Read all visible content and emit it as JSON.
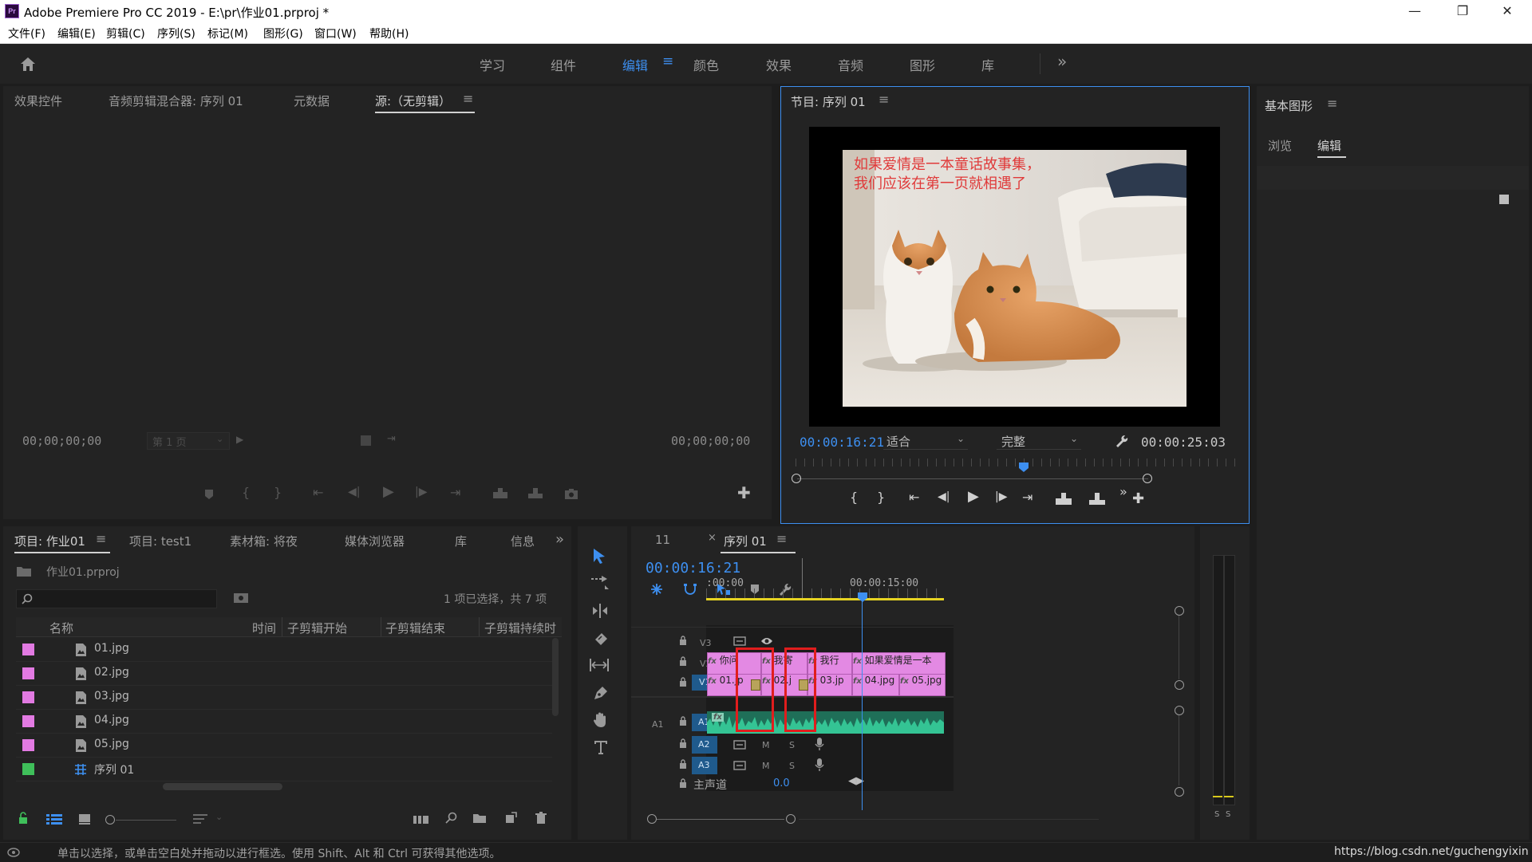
{
  "app": {
    "title": "Adobe Premiere Pro CC 2019 - E:\\pr\\作业01.prproj *",
    "logo": "Pr"
  },
  "menu": [
    "文件(F)",
    "编辑(E)",
    "剪辑(C)",
    "序列(S)",
    "标记(M)",
    "图形(G)",
    "窗口(W)",
    "帮助(H)"
  ],
  "workspaces": {
    "items": [
      "学习",
      "组件",
      "编辑",
      "颜色",
      "效果",
      "音频",
      "图形",
      "库"
    ],
    "active": "编辑",
    "more": "»"
  },
  "source_panel": {
    "tabs": [
      "效果控件",
      "音频剪辑混合器: 序列 01",
      "元数据",
      "源:（无剪辑）"
    ],
    "active_tab": "源:（无剪辑）",
    "timecode_left": "00;00;00;00",
    "page": "第 1 页",
    "timecode_right": "00;00;00;00"
  },
  "program_panel": {
    "title": "节目: 序列 01",
    "overlay_line1": "如果爱情是一本童话故事集，",
    "overlay_line2": "我们应该在第一页就相遇了",
    "timecode": "00:00:16:21",
    "fit": "适合",
    "quality": "完整",
    "duration": "00:00:25:03",
    "playhead_fraction": 0.65
  },
  "essential_graphics": {
    "title": "基本图形",
    "tabs": [
      "浏览",
      "编辑"
    ],
    "active_tab": "编辑"
  },
  "project_panel": {
    "tabs": [
      "项目: 作业01",
      "项目: test1",
      "素材箱: 将夜",
      "媒体浏览器",
      "库",
      "信息"
    ],
    "active_tab": "项目: 作业01",
    "file": "作业01.prproj",
    "search_placeholder": "",
    "selection_info": "1 项已选择，共 7 项",
    "columns": [
      "名称",
      "时间",
      "子剪辑开始",
      "子剪辑结束",
      "子剪辑持续时"
    ],
    "items": [
      {
        "name": "01.jpg",
        "color": "#e27ae2",
        "kind": "image"
      },
      {
        "name": "02.jpg",
        "color": "#e27ae2",
        "kind": "image"
      },
      {
        "name": "03.jpg",
        "color": "#e27ae2",
        "kind": "image"
      },
      {
        "name": "04.jpg",
        "color": "#e27ae2",
        "kind": "image"
      },
      {
        "name": "05.jpg",
        "color": "#e27ae2",
        "kind": "image"
      },
      {
        "name": "序列 01",
        "color": "#3fbf5a",
        "kind": "sequence"
      }
    ]
  },
  "timeline": {
    "tabs": [
      "11",
      "序列 01"
    ],
    "active_tab": "序列 01",
    "timecode": "00:00:16:21",
    "ruler": [
      ":00:00",
      "00:00:15:00"
    ],
    "tracks_video": [
      "V3",
      "V2",
      "V1"
    ],
    "tracks_audio": [
      "A1",
      "A2",
      "A3"
    ],
    "source_patch": "A1",
    "master_label": "主声道",
    "master_value": "0.0",
    "m_label": "M",
    "s_label": "S",
    "v2_clips": [
      "你问",
      "我寄",
      "我行",
      "如果爱情是一本"
    ],
    "v1_clips": [
      "01.jp",
      "02.j",
      "03.jp",
      "04.jpg",
      "05.jpg"
    ],
    "meter_labels": [
      "S",
      "S"
    ]
  },
  "status_bar": {
    "text": "单击以选择，或单击空白处并拖动以进行框选。使用 Shift、Alt 和 Ctrl 可获得其他选项。",
    "watermark": "https://blog.csdn.net/guchengyixin"
  },
  "colors": {
    "accent": "#3d8ff0",
    "clip_video": "#e389e3",
    "clip_audio": "#2fbf8f",
    "highlight_box": "#e11d1d",
    "work_area": "#e6d322"
  }
}
